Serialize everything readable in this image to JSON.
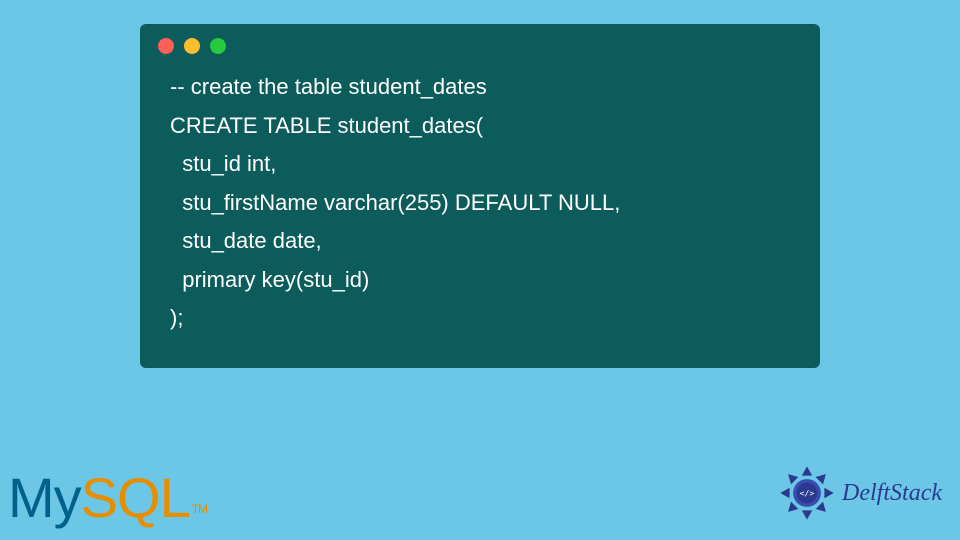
{
  "window": {
    "dots": [
      "red",
      "yellow",
      "green"
    ]
  },
  "code": {
    "line1": "-- create the table student_dates",
    "line2": "CREATE TABLE student_dates(",
    "line3": "  stu_id int,",
    "line4": "  stu_firstName varchar(255) DEFAULT NULL,",
    "line5": "  stu_date date,",
    "line6": "  primary key(stu_id)",
    "line7": ");"
  },
  "logos": {
    "mysql_my": "My",
    "mysql_sql": "SQL",
    "mysql_tm": "TM",
    "delft": "DelftStack"
  }
}
